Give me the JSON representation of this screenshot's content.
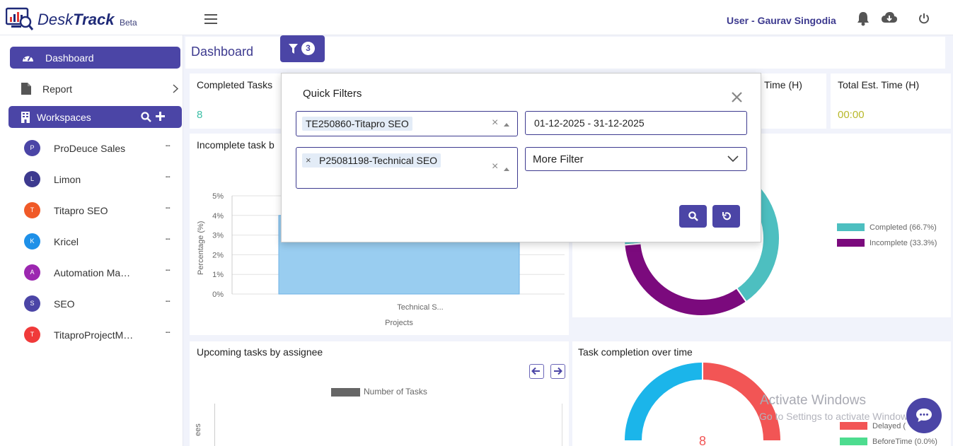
{
  "app": {
    "brand_prefix": "Desk",
    "brand_suffix": "Track",
    "beta": "Beta",
    "user": "User - Gaurav Singodia"
  },
  "sidebar": {
    "dashboard": "Dashboard",
    "report": "Report",
    "workspaces": "Workspaces",
    "items": [
      {
        "initial": "P",
        "name": "ProDeuce Sales",
        "color": "#4b45a6"
      },
      {
        "initial": "L",
        "name": "Limon",
        "color": "#3d3a8f"
      },
      {
        "initial": "T",
        "name": "Titapro SEO",
        "color": "#f05a28"
      },
      {
        "initial": "K",
        "name": "Kricel",
        "color": "#1e90e8"
      },
      {
        "initial": "A",
        "name": "Automation Ma…",
        "color": "#9c27b0"
      },
      {
        "initial": "S",
        "name": "SEO",
        "color": "#4b45a6"
      },
      {
        "initial": "T",
        "name": "TitaproProjectM…",
        "color": "#f03a3a"
      }
    ]
  },
  "main": {
    "title": "Dashboard",
    "filter_count": "3",
    "cards": {
      "completed_label": "Completed Tasks",
      "completed_value": "8",
      "time_label": "Time (H)",
      "est_label": "Total Est. Time (H)",
      "est_value": "00:00",
      "incomplete_title": "Incomplete task b",
      "upcoming_title": "Upcoming tasks by assignee",
      "completion_title": "Task completion over time"
    }
  },
  "charts": {
    "bar": {
      "ylabel": "Percentage (%)",
      "xlabel": "Projects",
      "category": "Technical S...",
      "ticks": [
        "5%",
        "4%",
        "3%",
        "2%",
        "1%",
        "0%"
      ]
    },
    "donut": {
      "legend": [
        "Completed (66.7%)",
        "Incomplete (33.3%)"
      ]
    },
    "upcoming": {
      "legend": "Number of Tasks",
      "ylabel_fragment": "ees"
    },
    "completion": {
      "center_value": "8",
      "legend": [
        "Delayed (",
        "BeforeTime (0.0%)"
      ]
    }
  },
  "chart_data": [
    {
      "type": "bar",
      "categories": [
        "Technical S..."
      ],
      "values": [
        4
      ],
      "xlabel": "Projects",
      "ylabel": "Percentage (%)",
      "ylim": [
        0,
        5
      ]
    },
    {
      "type": "pie",
      "labels": [
        "Completed",
        "Incomplete"
      ],
      "values": [
        66.7,
        33.3
      ],
      "legend_position": "right"
    }
  ],
  "quick_filters": {
    "title": "Quick Filters",
    "workspace_chip": "TE250860-Titapro SEO",
    "project_chip": "P25081198-Technical SEO",
    "date_range": "01-12-2025 - 31-12-2025",
    "more_filter": "More Filter",
    "clear_glyph": "×"
  },
  "overlay": {
    "watermark_title": "Activate Windows",
    "watermark_sub": "Go to Settings to activate Windows."
  }
}
